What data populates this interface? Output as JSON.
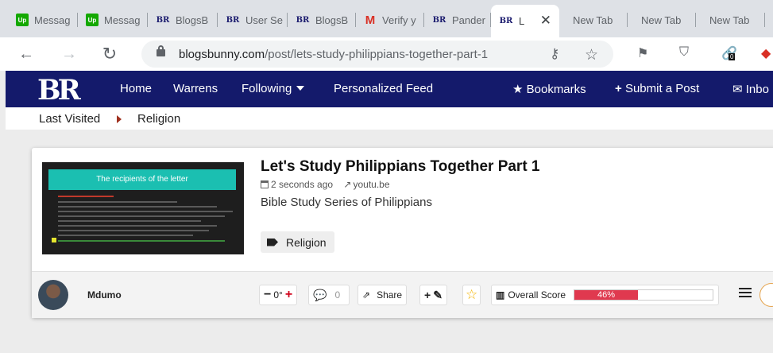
{
  "tabs": [
    {
      "favicon": "Up",
      "title": "Messag"
    },
    {
      "favicon": "Up",
      "title": "Messag"
    },
    {
      "favicon": "BR",
      "title": "BlogsB"
    },
    {
      "favicon": "BR",
      "title": "User Se"
    },
    {
      "favicon": "BR",
      "title": "BlogsB"
    },
    {
      "favicon": "M",
      "title": "Verify y"
    },
    {
      "favicon": "BR",
      "title": "Pander"
    },
    {
      "favicon": "BR",
      "title": "L"
    },
    {
      "favicon": "",
      "title": "New Tab"
    },
    {
      "favicon": "",
      "title": "New Tab"
    },
    {
      "favicon": "",
      "title": "New Tab"
    }
  ],
  "address": {
    "domain": "blogsbunny.com",
    "path": "/post/lets-study-philippians-together-part-1"
  },
  "icons": {
    "back": "arrow-left-icon",
    "forward": "arrow-right-icon",
    "reload": "reload-icon",
    "key": "key-icon",
    "star": "star-icon",
    "extension_badge": "0"
  },
  "site": {
    "logo": "BR",
    "nav": {
      "home": "Home",
      "warrens": "Warrens",
      "following": "Following",
      "feed": "Personalized Feed",
      "bookmarks": "Bookmarks",
      "submit": "Submit a Post",
      "inbox": "Inbo"
    }
  },
  "breadcrumb": {
    "last_visited": "Last Visited",
    "current": "Religion"
  },
  "post": {
    "thumbnail_title": "The recipients of the letter",
    "title": "Let's Study Philippians Together Part 1",
    "time": "2 seconds ago",
    "source": "youtu.be",
    "description": "Bible Study Series of Philippians",
    "tag": "Religion",
    "author": "Mdumo",
    "votes": "0°",
    "comments": "0",
    "share": "Share",
    "score_label": "Overall Score",
    "score_text": "46%",
    "score_value": 46
  },
  "colors": {
    "nav_bg": "#141a6b",
    "score": "#e0394f",
    "thumb_header": "#1bbfb1"
  }
}
